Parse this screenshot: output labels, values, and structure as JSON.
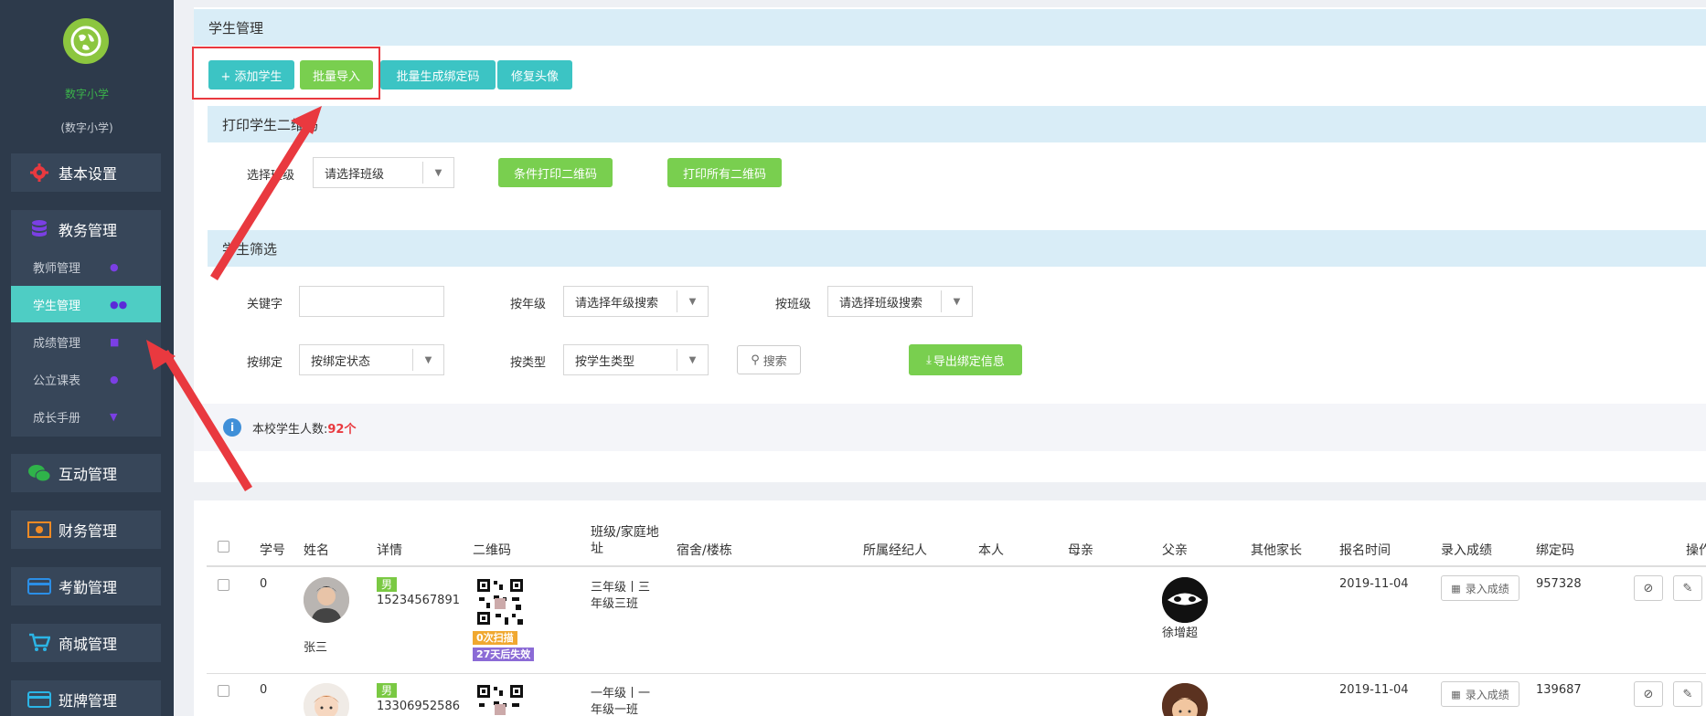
{
  "sidebar": {
    "school_name": "数字小学",
    "school_sub": "(数字小学)",
    "nav": [
      {
        "label": "基本设置",
        "icon": "gear-icon"
      },
      {
        "label": "互动管理",
        "icon": "wechat-icon"
      },
      {
        "label": "财务管理",
        "icon": "money-icon"
      },
      {
        "label": "考勤管理",
        "icon": "card-icon"
      },
      {
        "label": "商城管理",
        "icon": "cart-icon"
      },
      {
        "label": "班牌管理",
        "icon": "card-icon"
      }
    ],
    "edu": {
      "label": "教务管理",
      "icon": "database-icon",
      "items": [
        {
          "label": "教师管理",
          "icon": "user-icon"
        },
        {
          "label": "学生管理",
          "icon": "users-icon"
        },
        {
          "label": "成绩管理",
          "icon": "flag-icon"
        },
        {
          "label": "公立课表",
          "icon": "circle-icon"
        },
        {
          "label": "成长手册",
          "icon": "pin-icon"
        }
      ]
    }
  },
  "header": {
    "title": "学生管理"
  },
  "toolbar": {
    "add_label": "+ 添加学生",
    "import_label": "批量导入",
    "bind_label": "批量生成绑定码",
    "avatar_label": "修复头像"
  },
  "print_section": {
    "title": "打印学生二维码",
    "class_label": "选择班级",
    "class_select": "请选择班级",
    "cond_print": "条件打印二维码",
    "print_all": "打印所有二维码"
  },
  "filter": {
    "title": "学生筛选",
    "keyword_label": "关键字",
    "grade_label": "按年级",
    "grade_select": "请选择年级搜索",
    "class_label": "按班级",
    "class_select": "请选择班级搜索",
    "bind_label": "按绑定",
    "bind_select": "按绑定状态",
    "type_label": "按类型",
    "type_select": "按学生类型",
    "search": "搜索",
    "export": "导出绑定信息"
  },
  "summary": {
    "text": "本校学生人数:",
    "count": "92个"
  },
  "table": {
    "headers": [
      "学号",
      "姓名",
      "详情",
      "二维码",
      "班级/家庭地址",
      "宿舍/楼栋",
      "所属经纪人",
      "本人",
      "母亲",
      "父亲",
      "其他家长",
      "报名时间",
      "录入成绩",
      "绑定码",
      "操作"
    ],
    "rows": [
      {
        "id": "0",
        "name": "张三",
        "gender": "男",
        "phone": "15234567891",
        "scan": "0次扫描",
        "expire": "27天后失效",
        "class1": "三年级丨三",
        "class2": "年级三班",
        "father": "徐增超",
        "date": "2019-11-04",
        "score_btn": "录入成绩",
        "code": "957328"
      },
      {
        "id": "0",
        "name": "",
        "gender": "男",
        "phone": "13306952586",
        "scan": "",
        "expire": "",
        "class1": "一年级丨一",
        "class2": "年级一班",
        "father": "",
        "date": "2019-11-04",
        "score_btn": "录入成绩",
        "code": "139687"
      }
    ]
  },
  "colors": {
    "sidebar": "#2d3a4b",
    "accent": "#4ecdc4",
    "green": "#79cf4f",
    "highlight": "#e9393f",
    "count": "#e9393f"
  }
}
